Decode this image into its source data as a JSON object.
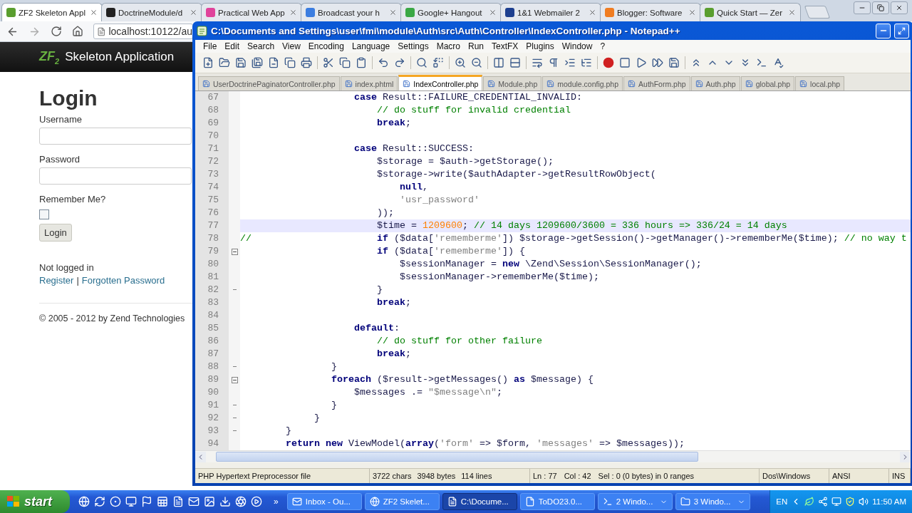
{
  "browser": {
    "tabs": [
      {
        "title": "ZF2 Skeleton Appl",
        "color": "#5a9e2f",
        "selected": true
      },
      {
        "title": "DoctrineModule/d",
        "color": "#222222",
        "selected": false
      },
      {
        "title": "Practical Web App",
        "color": "#e0439b",
        "selected": false
      },
      {
        "title": "Broadcast your h",
        "color": "#3b7de0",
        "selected": false
      },
      {
        "title": "Google+ Hangout",
        "color": "#3aa845",
        "selected": false
      },
      {
        "title": "1&1 Webmailer 2",
        "color": "#1d3f8f",
        "selected": false
      },
      {
        "title": "Blogger: Software",
        "color": "#f07d22",
        "selected": false
      },
      {
        "title": "Quick Start — Zer",
        "color": "#5a9e2f",
        "selected": false
      }
    ],
    "address": "localhost:10122/au",
    "site_header": {
      "logo": "ZF$_{2}$",
      "title": "Skeleton Application"
    },
    "login": {
      "heading": "Login",
      "fields": [
        {
          "label": "Username"
        },
        {
          "label": "Password"
        }
      ],
      "remember": {
        "label": "Remember Me?",
        "checked": false
      },
      "button": "Login",
      "status": "Not logged in",
      "links": [
        "Register",
        "Forgotten Password"
      ],
      "separator": "|",
      "footer": "© 2005 - 2012 by Zend Technologies"
    }
  },
  "editor": {
    "title": "C:\\Documents and Settings\\user\\fmi\\module\\Auth\\src\\Auth\\Controller\\IndexController.php - Notepad++",
    "menu": [
      "File",
      "Edit",
      "Search",
      "View",
      "Encoding",
      "Language",
      "Settings",
      "Macro",
      "Run",
      "TextFX",
      "Plugins",
      "Window",
      "?"
    ],
    "tabs": [
      {
        "label": "UserDoctrinePaginatorController.php",
        "selected": false
      },
      {
        "label": "index.phtml",
        "selected": false
      },
      {
        "label": "IndexController.php",
        "selected": true
      },
      {
        "label": "Module.php",
        "selected": false
      },
      {
        "label": "module.config.php",
        "selected": false
      },
      {
        "label": "AuthForm.php",
        "selected": false
      },
      {
        "label": "Auth.php",
        "selected": false
      },
      {
        "label": "global.php",
        "selected": false
      },
      {
        "label": "local.php",
        "selected": false
      }
    ],
    "lines": [
      {
        "number": "67",
        "current": false,
        "fold_start": false,
        "fold_end": false,
        "tokens": [
          {
            "kind": "keyword",
            "text": "                    case"
          },
          {
            "kind": "plain",
            "text": " Result::FAILURE_CREDENTIAL_INVALID:"
          }
        ]
      },
      {
        "number": "68",
        "current": false,
        "fold_start": false,
        "fold_end": false,
        "tokens": [
          {
            "kind": "comment",
            "text": "                        // do stuff for invalid credential"
          }
        ]
      },
      {
        "number": "69",
        "current": false,
        "fold_start": false,
        "fold_end": false,
        "tokens": [
          {
            "kind": "keyword",
            "text": "                        break"
          },
          {
            "kind": "plain",
            "text": ";"
          }
        ]
      },
      {
        "number": "70",
        "current": false,
        "fold_start": false,
        "fold_end": false
      },
      {
        "number": "71",
        "current": false,
        "fold_start": false,
        "fold_end": false,
        "tokens": [
          {
            "kind": "keyword",
            "text": "                    case"
          },
          {
            "kind": "plain",
            "text": " Result::SUCCESS:"
          }
        ]
      },
      {
        "number": "72",
        "current": false,
        "fold_start": false,
        "fold_end": false,
        "tokens": [
          {
            "kind": "plain",
            "text": "                        $storage = $auth->getStorage();"
          }
        ]
      },
      {
        "number": "73",
        "current": false,
        "fold_start": false,
        "fold_end": false,
        "tokens": [
          {
            "kind": "plain",
            "text": "                        $storage->write($authAdapter->getResultRowObject("
          }
        ]
      },
      {
        "number": "74",
        "current": false,
        "fold_start": false,
        "fold_end": false,
        "tokens": [
          {
            "kind": "keyword",
            "text": "                            null"
          },
          {
            "kind": "plain",
            "text": ","
          }
        ]
      },
      {
        "number": "75",
        "current": false,
        "fold_start": false,
        "fold_end": false,
        "tokens": [
          {
            "kind": "string",
            "text": "                            'usr_password'"
          }
        ]
      },
      {
        "number": "76",
        "current": false,
        "fold_start": false,
        "fold_end": false,
        "tokens": [
          {
            "kind": "plain",
            "text": "                        ));"
          }
        ]
      },
      {
        "number": "77",
        "current": true,
        "fold_start": false,
        "fold_end": false,
        "tokens": [
          {
            "kind": "plain",
            "text": "                        $time = "
          },
          {
            "kind": "number",
            "text": "1209600"
          },
          {
            "kind": "plain",
            "text": "; "
          },
          {
            "kind": "comment",
            "text": "// 14 days 1209600/3600 = 336 hours => 336/24 = 14 days"
          }
        ]
      },
      {
        "number": "78",
        "current": false,
        "fold_start": false,
        "fold_end": false,
        "tokens": [
          {
            "kind": "comment",
            "text": "//"
          },
          {
            "kind": "keyword",
            "text": "                      if"
          },
          {
            "kind": "plain",
            "text": " ($data["
          },
          {
            "kind": "string",
            "text": "'rememberme'"
          },
          {
            "kind": "plain",
            "text": "]) $storage->getSession()->getManager()->rememberMe($time); "
          },
          {
            "kind": "comment",
            "text": "// no way t"
          }
        ]
      },
      {
        "number": "79",
        "current": false,
        "fold_start": true,
        "fold_end": false,
        "tokens": [
          {
            "kind": "keyword",
            "text": "                        if"
          },
          {
            "kind": "plain",
            "text": " ($data["
          },
          {
            "kind": "string",
            "text": "'rememberme'"
          },
          {
            "kind": "plain",
            "text": "]) {"
          }
        ]
      },
      {
        "number": "80",
        "current": false,
        "fold_start": false,
        "fold_end": false,
        "tokens": [
          {
            "kind": "plain",
            "text": "                            $sessionManager = "
          },
          {
            "kind": "keyword",
            "text": "new"
          },
          {
            "kind": "plain",
            "text": " \\Zend\\Session\\SessionManager();"
          }
        ]
      },
      {
        "number": "81",
        "current": false,
        "fold_start": false,
        "fold_end": false,
        "tokens": [
          {
            "kind": "plain",
            "text": "                            $sessionManager->rememberMe($time);"
          }
        ]
      },
      {
        "number": "82",
        "current": false,
        "fold_start": false,
        "fold_end": true,
        "tokens": [
          {
            "kind": "plain",
            "text": "                        }"
          }
        ]
      },
      {
        "number": "83",
        "current": false,
        "fold_start": false,
        "fold_end": false,
        "tokens": [
          {
            "kind": "keyword",
            "text": "                        break"
          },
          {
            "kind": "plain",
            "text": ";"
          }
        ]
      },
      {
        "number": "84",
        "current": false,
        "fold_start": false,
        "fold_end": false
      },
      {
        "number": "85",
        "current": false,
        "fold_start": false,
        "fold_end": false,
        "tokens": [
          {
            "kind": "keyword",
            "text": "                    default"
          },
          {
            "kind": "plain",
            "text": ":"
          }
        ]
      },
      {
        "number": "86",
        "current": false,
        "fold_start": false,
        "fold_end": false,
        "tokens": [
          {
            "kind": "comment",
            "text": "                        // do stuff for other failure"
          }
        ]
      },
      {
        "number": "87",
        "current": false,
        "fold_start": false,
        "fold_end": false,
        "tokens": [
          {
            "kind": "keyword",
            "text": "                        break"
          },
          {
            "kind": "plain",
            "text": ";"
          }
        ]
      },
      {
        "number": "88",
        "current": false,
        "fold_start": false,
        "fold_end": true,
        "tokens": [
          {
            "kind": "plain",
            "text": "                }"
          }
        ]
      },
      {
        "number": "89",
        "current": false,
        "fold_start": true,
        "fold_end": false,
        "tokens": [
          {
            "kind": "keyword",
            "text": "                foreach"
          },
          {
            "kind": "plain",
            "text": " ($result->getMessages() "
          },
          {
            "kind": "keyword",
            "text": "as"
          },
          {
            "kind": "plain",
            "text": " $message) {"
          }
        ]
      },
      {
        "number": "90",
        "current": false,
        "fold_start": false,
        "fold_end": false,
        "tokens": [
          {
            "kind": "plain",
            "text": "                    $messages .= "
          },
          {
            "kind": "string",
            "text": "\"$message\\n\""
          },
          {
            "kind": "plain",
            "text": ";"
          }
        ]
      },
      {
        "number": "91",
        "current": false,
        "fold_start": false,
        "fold_end": true,
        "tokens": [
          {
            "kind": "plain",
            "text": "                }"
          }
        ]
      },
      {
        "number": "92",
        "current": false,
        "fold_start": false,
        "fold_end": true,
        "tokens": [
          {
            "kind": "plain",
            "text": "             }"
          }
        ]
      },
      {
        "number": "93",
        "current": false,
        "fold_start": false,
        "fold_end": true,
        "tokens": [
          {
            "kind": "plain",
            "text": "        }"
          }
        ]
      },
      {
        "number": "94",
        "current": false,
        "fold_start": false,
        "fold_end": false,
        "tokens": [
          {
            "kind": "keyword",
            "text": "        return"
          },
          {
            "kind": "keyword",
            "text": " new"
          },
          {
            "kind": "plain",
            "text": " ViewModel("
          },
          {
            "kind": "keyword",
            "text": "array"
          },
          {
            "kind": "plain",
            "text": "("
          },
          {
            "kind": "string",
            "text": "'form'"
          },
          {
            "kind": "plain",
            "text": " => $form, "
          },
          {
            "kind": "string",
            "text": "'messages'"
          },
          {
            "kind": "plain",
            "text": " => $messages));"
          }
        ]
      }
    ],
    "status": {
      "type": "PHP Hypertext Preprocessor file",
      "counts": [
        "3722 chars",
        "3948 bytes",
        "114 lines"
      ],
      "position": [
        "Ln : 77",
        "Col : 42",
        "Sel : 0 (0 bytes) in 0 ranges"
      ],
      "eol": "Dos\\Windows",
      "encoding": "ANSI",
      "mode": "INS"
    }
  },
  "taskbar": {
    "start": "start",
    "more": "»",
    "tasks": [
      {
        "label": "Inbox - Ou...",
        "selected": false,
        "grouped": false
      },
      {
        "label": "ZF2 Skelet...",
        "selected": false,
        "grouped": false
      },
      {
        "label": "C:\\Docume...",
        "selected": true,
        "grouped": false
      },
      {
        "label": "ToDO23.0...",
        "selected": false,
        "grouped": false
      },
      {
        "label": "2 Windo...",
        "selected": false,
        "grouped": true
      },
      {
        "label": "3 Windo...",
        "selected": false,
        "grouped": true
      }
    ],
    "language": "EN",
    "clock": "11:50 AM"
  }
}
